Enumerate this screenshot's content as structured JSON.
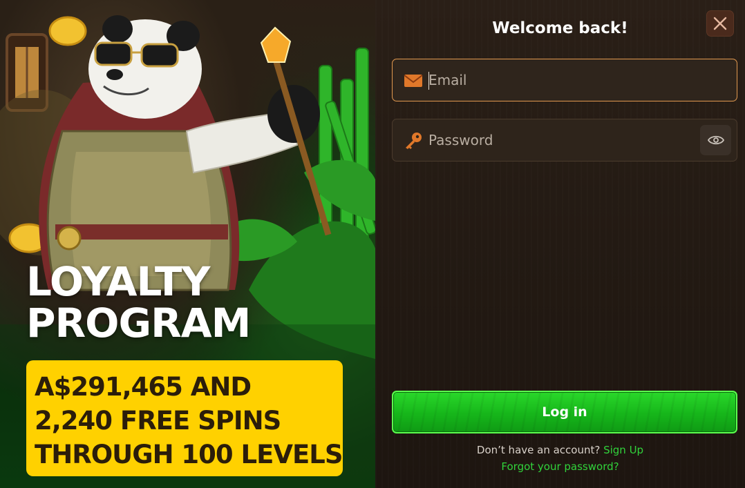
{
  "promo": {
    "headline_line1": "LOYALTY",
    "headline_line2": "PROGRAM",
    "box_line1": "A$291,465 AND",
    "box_line2": "2,240 FREE SPINS",
    "box_line3": "THROUGH 100 LEVELS",
    "box_color": "#ffd100",
    "icon": "panda-mascot-illustration"
  },
  "modal": {
    "title": "Welcome back!",
    "email": {
      "value": "",
      "placeholder": "Email",
      "icon": "envelope-icon"
    },
    "password": {
      "value": "",
      "placeholder": "Password",
      "icon": "key-icon",
      "toggle_icon": "eye-icon"
    },
    "login_label": "Log in",
    "signup_prompt": "Don’t have an account?",
    "signup_link": "Sign Up",
    "forgot_link": "Forgot your password?",
    "close_icon": "close-icon",
    "colors": {
      "accent_green": "#22c92a",
      "link_green": "#31d33b",
      "focus_orange": "#e39a50"
    }
  }
}
